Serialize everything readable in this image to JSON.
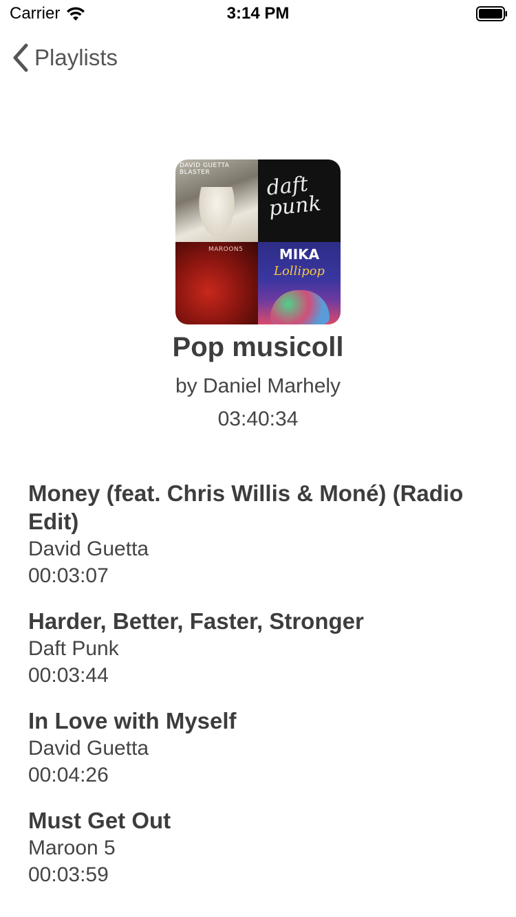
{
  "status_bar": {
    "carrier": "Carrier",
    "time": "3:14 PM",
    "wifi_icon": "wifi-icon",
    "battery_icon": "battery-icon"
  },
  "nav": {
    "back_icon": "chevron-left-icon",
    "back_label": "Playlists"
  },
  "artwork": {
    "tiles": [
      {
        "name": "david-guetta-blaster-cover",
        "text": "DAVID GUETTA BLASTER"
      },
      {
        "name": "daft-punk-discovery-cover",
        "text": "daft punk"
      },
      {
        "name": "maroon-5-songs-about-jane-cover",
        "text": "MAROON5"
      },
      {
        "name": "mika-lollipop-cover",
        "text_1": "MIKA",
        "text_2": "Lollipop"
      }
    ]
  },
  "playlist": {
    "title": "Pop musicoll",
    "owner": "by Daniel Marhely",
    "duration": "03:40:34"
  },
  "tracks": [
    {
      "title": "Money (feat. Chris Willis & Moné) (Radio Edit)",
      "artist": "David Guetta",
      "duration": "00:03:07"
    },
    {
      "title": "Harder, Better, Faster, Stronger",
      "artist": "Daft Punk",
      "duration": "00:03:44"
    },
    {
      "title": "In Love with Myself",
      "artist": "David Guetta",
      "duration": "00:04:26"
    },
    {
      "title": "Must Get Out",
      "artist": "Maroon 5",
      "duration": "00:03:59"
    }
  ],
  "colors": {
    "text_primary": "#3d3d3d",
    "text_secondary": "#444444",
    "background": "#ffffff"
  }
}
